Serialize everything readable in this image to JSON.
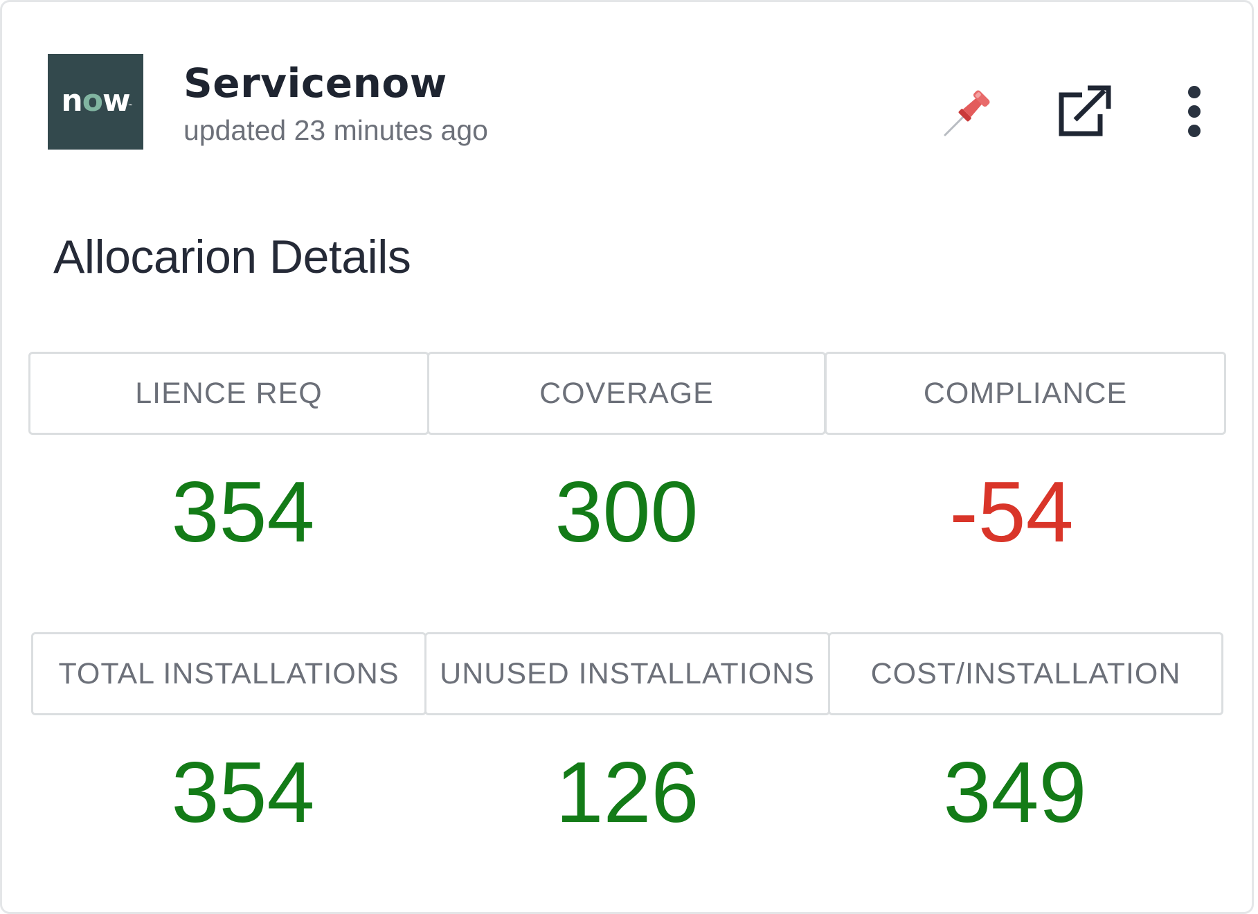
{
  "header": {
    "logo_text": "now",
    "logo_tm": "™",
    "title": "Servicenow",
    "updated": "updated 23 minutes ago",
    "icons": [
      "pin-icon",
      "external-link-icon",
      "more-vertical-icon"
    ]
  },
  "section": {
    "title": "Allocarion Details"
  },
  "metrics": [
    {
      "label": "LIENCE REQ",
      "value": "354",
      "status": "positive"
    },
    {
      "label": "COVERAGE",
      "value": "300",
      "status": "positive"
    },
    {
      "label": "COMPLIANCE",
      "value": "-54",
      "status": "negative"
    },
    {
      "label": "TOTAL INSTALLATIONS",
      "value": "354",
      "status": "positive"
    },
    {
      "label": "UNUSED INSTALLATIONS",
      "value": "126",
      "status": "positive"
    },
    {
      "label": "COST/INSTALLATION",
      "value": "349",
      "status": "positive"
    }
  ],
  "colors": {
    "positive": "#137b17",
    "negative": "#d93529",
    "logo_bg": "#33494d",
    "logo_accent": "#81b5a1"
  }
}
